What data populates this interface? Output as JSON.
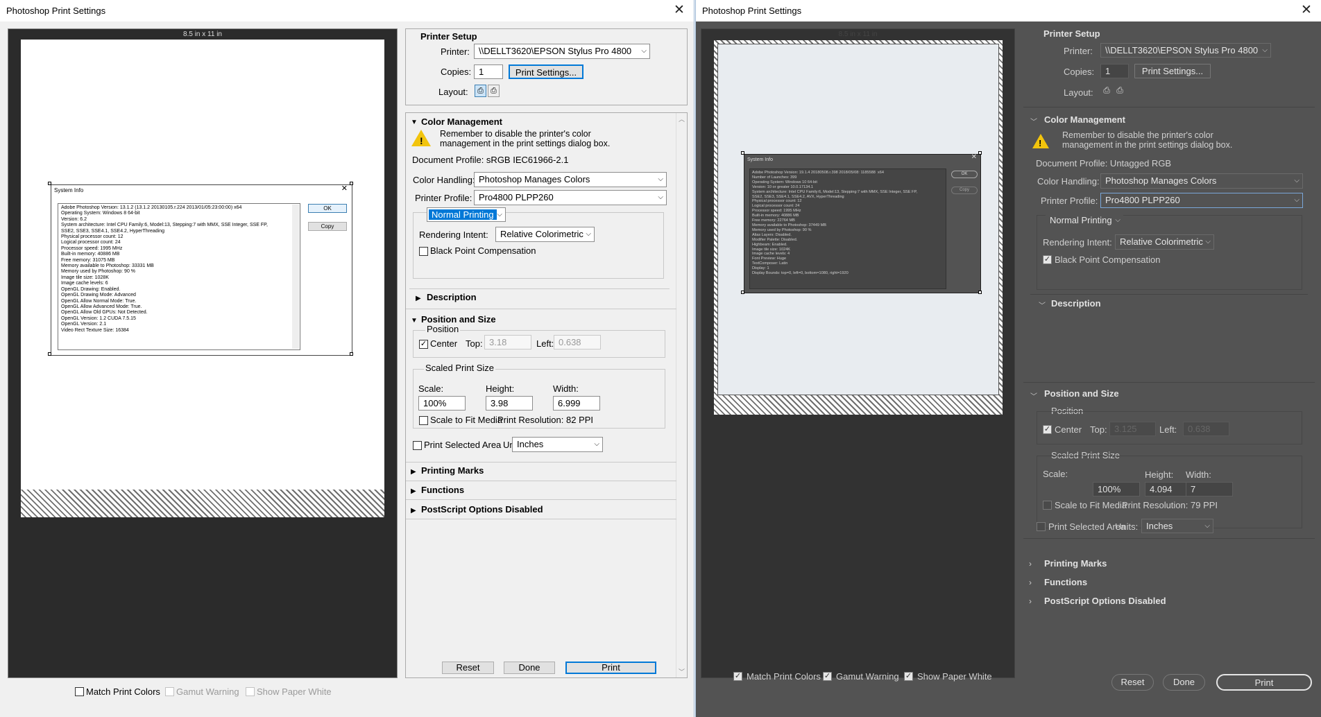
{
  "left": {
    "window_title": "Photoshop Print Settings",
    "paper_size": "8.5 in x 11 in",
    "printer_setup": {
      "header": "Printer Setup",
      "printer_label": "Printer:",
      "printer": "\\\\DELLT3620\\EPSON Stylus Pro 4800",
      "copies_label": "Copies:",
      "copies": "1",
      "print_settings": "Print Settings...",
      "layout_label": "Layout:"
    },
    "color_management": {
      "header": "Color Management",
      "warning": "Remember to disable the printer's color management in the print settings dialog box.",
      "doc_profile": "Document Profile: sRGB IEC61966-2.1",
      "handling_label": "Color Handling:",
      "handling": "Photoshop Manages Colors",
      "printer_profile_label": "Printer Profile:",
      "printer_profile": "Pro4800 PLPP260",
      "normal_printing": "Normal Printing",
      "intent_label": "Rendering Intent:",
      "intent": "Relative Colorimetric",
      "bpc": "Black Point Compensation"
    },
    "description": "Description",
    "position_size": {
      "header": "Position and Size",
      "position": "Position",
      "center": "Center",
      "top_label": "Top:",
      "top": "3.18",
      "left_label": "Left:",
      "left": "0.638",
      "scaled": "Scaled Print Size",
      "scale_label": "Scale:",
      "scale": "100%",
      "height_label": "Height:",
      "height": "3.98",
      "width_label": "Width:",
      "width": "6.999",
      "fit": "Scale to Fit Media",
      "resolution": "Print Resolution: 82 PPI",
      "selected_area": "Print Selected Area",
      "units_label": "Units:",
      "units": "Inches"
    },
    "printing_marks": "Printing Marks",
    "functions": "Functions",
    "postscript": "PostScript Options Disabled",
    "match_colors": "Match Print Colors",
    "gamut_warning": "Gamut Warning",
    "paper_white": "Show Paper White",
    "reset": "Reset",
    "done": "Done",
    "print": "Print",
    "sysinfo": {
      "title": "System Info",
      "ok": "OK",
      "copy": "Copy",
      "text": "Adobe Photoshop Version: 13.1.2 (13.1.2 20130105.r.224 2013/01/05:23:00:00) x64\nOperating System: Windows 8 64-bit\nVersion: 6.2\nSystem architecture: Intel CPU Family:6, Model:13, Stepping:7 with MMX, SSE Integer, SSE FP,\nSSE2, SSE3, SSE4.1, SSE4.2, HyperThreading\nPhysical processor count: 12\nLogical processor count: 24\nProcessor speed: 1995 MHz\nBuilt-in memory: 40886 MB\nFree memory: 31075 MB\nMemory available to Photoshop: 33331 MB\nMemory used by Photoshop: 90 %\nImage tile size: 1028K\nImage cache levels: 6\nOpenGL Drawing: Enabled.\nOpenGL Drawing Mode: Advanced\nOpenGL Allow Normal Mode: True.\nOpenGL Allow Advanced Mode: True.\nOpenGL Allow Old GPUs: Not Detected.\nOpenGL Version: 1.2 CUDA 7.5.15\nOpenGL Version: 2.1\nVideo Rect Texture Size: 16384"
    }
  },
  "right": {
    "window_title": "Photoshop Print Settings",
    "paper_size": "8.5 in x 11 in",
    "printer_setup": {
      "header": "Printer Setup",
      "printer_label": "Printer:",
      "printer": "\\\\DELLT3620\\EPSON Stylus Pro 4800",
      "copies_label": "Copies:",
      "copies": "1",
      "print_settings": "Print Settings...",
      "layout_label": "Layout:"
    },
    "color_management": {
      "header": "Color Management",
      "warning": "Remember to disable the printer's color management in the print settings dialog box.",
      "doc_profile": "Document Profile: Untagged RGB",
      "handling_label": "Color Handling:",
      "handling": "Photoshop Manages Colors",
      "printer_profile_label": "Printer Profile:",
      "printer_profile": "Pro4800 PLPP260",
      "normal_printing": "Normal Printing",
      "intent_label": "Rendering Intent:",
      "intent": "Relative Colorimetric",
      "bpc": "Black Point Compensation"
    },
    "description": "Description",
    "position_size": {
      "header": "Position and Size",
      "position": "Position",
      "center": "Center",
      "top_label": "Top:",
      "top": "3.125",
      "left_label": "Left:",
      "left": "0.638",
      "scaled": "Scaled Print Size",
      "scale_label": "Scale:",
      "scale": "100%",
      "height_label": "Height:",
      "height": "4.094",
      "width_label": "Width:",
      "width": "7",
      "fit": "Scale to Fit Media",
      "resolution": "Print Resolution: 79 PPI",
      "selected_area": "Print Selected Area",
      "units_label": "Units:",
      "units": "Inches"
    },
    "printing_marks": "Printing Marks",
    "functions": "Functions",
    "postscript": "PostScript Options Disabled",
    "match_colors": "Match Print Colors",
    "gamut_warning": "Gamut Warning",
    "paper_white": "Show Paper White",
    "reset": "Reset",
    "done": "Done",
    "print": "Print",
    "sysinfo": {
      "title": "System Info",
      "ok": "OK",
      "copy": "Copy",
      "text": "Adobe Photoshop Version: 19.1.4 20180508.r.398 2018/05/08: 1185588  x64\nNumber of Launches: 399\nOperating System: Windows 10 64-bit\nVersion: 10 or greater 10.0.17134.1\nSystem architecture: Intel CPU Family:6, Model:13, Stepping:7 with MMX, SSE Integer, SSE FP,\nSSE2, SSE3, SSE4.1, SSE4.2, AVX, HyperThreading\nPhysical processor count: 12\nLogical processor count: 24\nProcessor speed: 1995 MHz\nBuilt-in memory: 40886 MB\nFree memory: 22764 MB\nMemory available to Photoshop: 37449 MB\nMemory used by Photoshop: 90 %\nAlias Layers: Disabled.\nModifier Palette: Disabled.\nHighbeam: Enabled.\nImage tile size: 1024K\nImage cache levels: 4\nFont Preview: Huge\nTextComposer: Latin\nDisplay: 1\nDisplay Bounds: top=0, left=0, bottom=1080, right=1920"
    }
  }
}
